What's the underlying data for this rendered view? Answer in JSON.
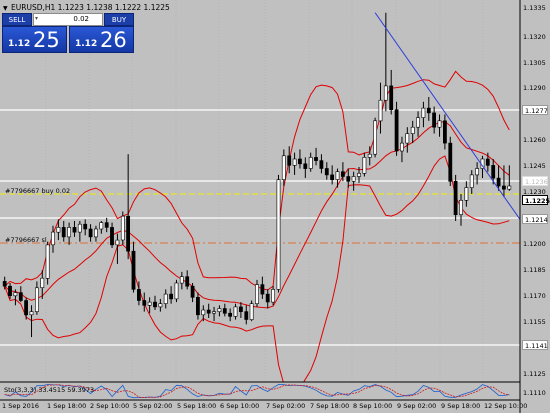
{
  "symbol": {
    "title": "EURUSD,H1",
    "ohlc": "1.1223 1.1238 1.1222 1.1225"
  },
  "trade_panel": {
    "sell_label": "SELL",
    "buy_label": "BUY",
    "lot_value": "0.02",
    "sell_price_small": "1.12",
    "sell_price_big": "25",
    "buy_price_small": "1.12",
    "buy_price_big": "26"
  },
  "orders": [
    {
      "label": "#7796667 buy 0.02"
    },
    {
      "label": "#7796667 sl"
    }
  ],
  "price_axis": {
    "ticks": [
      "1.1335",
      "1.1320",
      "1.1305",
      "1.1290",
      "1.1260",
      "1.1245",
      "1.1230",
      "1.1200",
      "1.1185",
      "1.1170",
      "1.1155",
      "1.1125",
      "1.1110"
    ],
    "tags": {
      "level_high": "1.1277",
      "faint": "1.1236",
      "current": "1.1225",
      "level_mid": "1.1214",
      "level_low": "1.1141"
    }
  },
  "time_axis": [
    "1 Sep 2016",
    "1 Sep 18:00",
    "2 Sep 10:00",
    "5 Sep 02:00",
    "5 Sep 18:00",
    "6 Sep 10:00",
    "7 Sep 02:00",
    "7 Sep 18:00",
    "8 Sep 10:00",
    "9 Sep 02:00",
    "9 Sep 18:00",
    "12 Sep 10:00"
  ],
  "indicator": {
    "label": "Sto(3,3,3) 33.4515 59.3973"
  },
  "colors": {
    "background": "#c0c0c0",
    "bull_candle": "#ffffff",
    "bear_candle": "#000000",
    "bollinger": "#e00000",
    "trendline": "#2f3fd8",
    "hline": "#ffffff",
    "order_line": "#f0f000",
    "sl_line": "#e07030",
    "button_blue": "#1b3ea8"
  },
  "chart_data": {
    "type": "candlestick",
    "ylim": [
      1.1103,
      1.1342
    ],
    "candles": [
      [
        1.1165,
        1.1168,
        1.116,
        1.1162
      ],
      [
        1.1162,
        1.1164,
        1.1154,
        1.1156
      ],
      [
        1.1156,
        1.116,
        1.115,
        1.1158
      ],
      [
        1.1158,
        1.1162,
        1.1152,
        1.1153
      ],
      [
        1.1153,
        1.1155,
        1.1141,
        1.1144
      ],
      [
        1.1144,
        1.115,
        1.113,
        1.1146
      ],
      [
        1.1146,
        1.1165,
        1.1144,
        1.1161
      ],
      [
        1.1161,
        1.1172,
        1.1154,
        1.1167
      ],
      [
        1.1167,
        1.119,
        1.1163,
        1.1188
      ],
      [
        1.1188,
        1.12,
        1.1183,
        1.1196
      ],
      [
        1.1196,
        1.1204,
        1.1191,
        1.1199
      ],
      [
        1.1199,
        1.1203,
        1.119,
        1.1193
      ],
      [
        1.1193,
        1.1202,
        1.1188,
        1.1199
      ],
      [
        1.1199,
        1.1203,
        1.1193,
        1.1196
      ],
      [
        1.1196,
        1.1203,
        1.119,
        1.1201
      ],
      [
        1.1201,
        1.1204,
        1.1194,
        1.1198
      ],
      [
        1.1198,
        1.1201,
        1.119,
        1.1193
      ],
      [
        1.1193,
        1.12,
        1.119,
        1.1198
      ],
      [
        1.1198,
        1.1203,
        1.1195,
        1.1202
      ],
      [
        1.1202,
        1.1205,
        1.1196,
        1.1199
      ],
      [
        1.1199,
        1.1202,
        1.1186,
        1.1188
      ],
      [
        1.1188,
        1.1195,
        1.1176,
        1.1191
      ],
      [
        1.1191,
        1.1209,
        1.1188,
        1.1206
      ],
      [
        1.1206,
        1.1245,
        1.1179,
        1.1184
      ],
      [
        1.1184,
        1.119,
        1.1158,
        1.116
      ],
      [
        1.116,
        1.1165,
        1.115,
        1.1153
      ],
      [
        1.1153,
        1.1158,
        1.1146,
        1.115
      ],
      [
        1.115,
        1.1155,
        1.1145,
        1.1152
      ],
      [
        1.1152,
        1.1156,
        1.1147,
        1.1149
      ],
      [
        1.1149,
        1.1154,
        1.1146,
        1.1151
      ],
      [
        1.1151,
        1.116,
        1.1148,
        1.1157
      ],
      [
        1.1157,
        1.1162,
        1.1151,
        1.1154
      ],
      [
        1.1154,
        1.1166,
        1.1152,
        1.1164
      ],
      [
        1.1164,
        1.1171,
        1.116,
        1.1168
      ],
      [
        1.1168,
        1.1172,
        1.116,
        1.1162
      ],
      [
        1.1162,
        1.1164,
        1.1152,
        1.1155
      ],
      [
        1.1155,
        1.1158,
        1.1141,
        1.1144
      ],
      [
        1.1144,
        1.115,
        1.114,
        1.1147
      ],
      [
        1.1147,
        1.1151,
        1.1142,
        1.1145
      ],
      [
        1.1145,
        1.1149,
        1.114,
        1.1146
      ],
      [
        1.1146,
        1.115,
        1.1143,
        1.1148
      ],
      [
        1.1148,
        1.1151,
        1.1143,
        1.1145
      ],
      [
        1.1145,
        1.1148,
        1.114,
        1.1143
      ],
      [
        1.1143,
        1.1151,
        1.1141,
        1.1149
      ],
      [
        1.1149,
        1.1152,
        1.1142,
        1.1146
      ],
      [
        1.1146,
        1.115,
        1.1138,
        1.1141
      ],
      [
        1.1141,
        1.1153,
        1.114,
        1.1151
      ],
      [
        1.1151,
        1.1166,
        1.1149,
        1.1163
      ],
      [
        1.1163,
        1.1168,
        1.1154,
        1.1157
      ],
      [
        1.1157,
        1.116,
        1.1148,
        1.1152
      ],
      [
        1.1152,
        1.1162,
        1.115,
        1.116
      ],
      [
        1.116,
        1.1232,
        1.1158,
        1.1229
      ],
      [
        1.1229,
        1.1248,
        1.1225,
        1.1244
      ],
      [
        1.1244,
        1.125,
        1.1233,
        1.1238
      ],
      [
        1.1238,
        1.1246,
        1.1232,
        1.1242
      ],
      [
        1.1242,
        1.1248,
        1.1236,
        1.1239
      ],
      [
        1.1239,
        1.1243,
        1.123,
        1.1236
      ],
      [
        1.1236,
        1.1246,
        1.1234,
        1.1243
      ],
      [
        1.1243,
        1.1249,
        1.1238,
        1.1241
      ],
      [
        1.1241,
        1.1245,
        1.1233,
        1.1236
      ],
      [
        1.1236,
        1.124,
        1.1229,
        1.1232
      ],
      [
        1.1232,
        1.1238,
        1.1226,
        1.1229
      ],
      [
        1.1229,
        1.1236,
        1.1224,
        1.1234
      ],
      [
        1.1234,
        1.124,
        1.1228,
        1.1231
      ],
      [
        1.1231,
        1.1236,
        1.1224,
        1.1228
      ],
      [
        1.1228,
        1.1234,
        1.1222,
        1.1231
      ],
      [
        1.1231,
        1.1237,
        1.1227,
        1.1233
      ],
      [
        1.1233,
        1.1246,
        1.1231,
        1.1243
      ],
      [
        1.1243,
        1.125,
        1.1238,
        1.1245
      ],
      [
        1.1245,
        1.1268,
        1.1243,
        1.1266
      ],
      [
        1.1266,
        1.129,
        1.1258,
        1.1279
      ],
      [
        1.1279,
        1.1334,
        1.1272,
        1.1288
      ],
      [
        1.1288,
        1.1298,
        1.127,
        1.1273
      ],
      [
        1.1273,
        1.1278,
        1.1244,
        1.1247
      ],
      [
        1.1247,
        1.1256,
        1.124,
        1.1252
      ],
      [
        1.1252,
        1.1262,
        1.1246,
        1.1258
      ],
      [
        1.1258,
        1.1266,
        1.1252,
        1.1262
      ],
      [
        1.1262,
        1.1272,
        1.1256,
        1.1268
      ],
      [
        1.1268,
        1.1278,
        1.1262,
        1.1274
      ],
      [
        1.1274,
        1.1281,
        1.1266,
        1.1271
      ],
      [
        1.1271,
        1.1275,
        1.1258,
        1.1262
      ],
      [
        1.1262,
        1.127,
        1.1256,
        1.1266
      ],
      [
        1.1266,
        1.127,
        1.1248,
        1.1252
      ],
      [
        1.1252,
        1.1256,
        1.1225,
        1.1228
      ],
      [
        1.1228,
        1.1232,
        1.1203,
        1.1207
      ],
      [
        1.1207,
        1.122,
        1.12,
        1.1216
      ],
      [
        1.1216,
        1.1228,
        1.1212,
        1.1224
      ],
      [
        1.1224,
        1.1235,
        1.122,
        1.1232
      ],
      [
        1.1232,
        1.124,
        1.1226,
        1.1236
      ],
      [
        1.1236,
        1.1244,
        1.123,
        1.1242
      ],
      [
        1.1242,
        1.1246,
        1.1234,
        1.1238
      ],
      [
        1.1238,
        1.1242,
        1.1226,
        1.123
      ],
      [
        1.123,
        1.1238,
        1.1222,
        1.1225
      ],
      [
        1.1225,
        1.1238,
        1.1218,
        1.1223
      ],
      [
        1.1223,
        1.1238,
        1.1222,
        1.1225
      ]
    ]
  }
}
